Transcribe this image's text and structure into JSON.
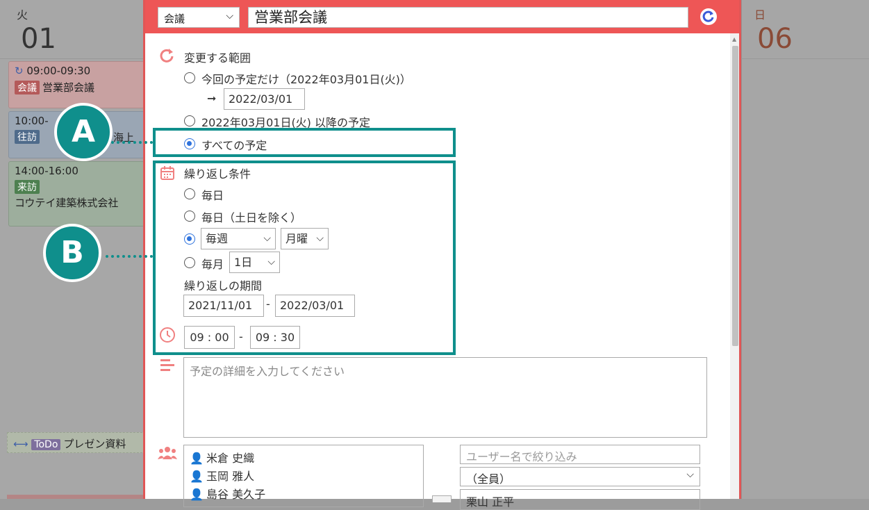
{
  "calendar": {
    "left_day_name": "火",
    "left_day_num": "01",
    "right_day_name": "日",
    "right_day_num": "06",
    "events": [
      {
        "time": "09:00-09:30",
        "tag": "会議",
        "title": "営業部会議"
      },
      {
        "time": "10:00-",
        "tag": "往訪",
        "title": "海上"
      },
      {
        "time": "14:00-16:00",
        "tag": "来訪",
        "title": "コウテイ建築株式会社"
      }
    ],
    "todo_tag": "ToDo",
    "todo_title": "プレゼン資料"
  },
  "dialog": {
    "category": "会議",
    "title": "営業部会議",
    "scope": {
      "label": "変更する範囲",
      "option_this": "今回の予定だけ（2022年03月01日(火)）",
      "arrow": "➞",
      "this_date": "2022/03/01",
      "option_after": "2022年03月01日(火) 以降の予定",
      "option_all": "すべての予定",
      "selected": "all"
    },
    "repeat": {
      "label": "繰り返し条件",
      "opt_daily": "毎日",
      "opt_weekdays": "毎日（土日を除く）",
      "weekly_value": "毎週",
      "weekday_value": "月曜",
      "opt_monthly": "毎月",
      "monthly_day": "1日",
      "period_label": "繰り返しの期間",
      "period_start": "2021/11/01",
      "period_sep": "-",
      "period_end": "2022/03/01",
      "selected": "weekly"
    },
    "time": {
      "start": "09 : 00",
      "sep": "-",
      "end": "09 : 30"
    },
    "detail_placeholder": "予定の詳細を入力してください",
    "users": [
      "米倉 史織",
      "玉岡 雅人",
      "島谷 美久子"
    ],
    "filter_placeholder": "ユーザー名で絞り込み",
    "group_value": "（全員）",
    "candidate_partial": "栗山 正平"
  },
  "annotations": {
    "a": "A",
    "b": "B"
  },
  "colors": {
    "header": "#ee5656",
    "highlight": "#0f8f8c",
    "radio_on": "#2f73dd",
    "icon": "#f08080"
  }
}
